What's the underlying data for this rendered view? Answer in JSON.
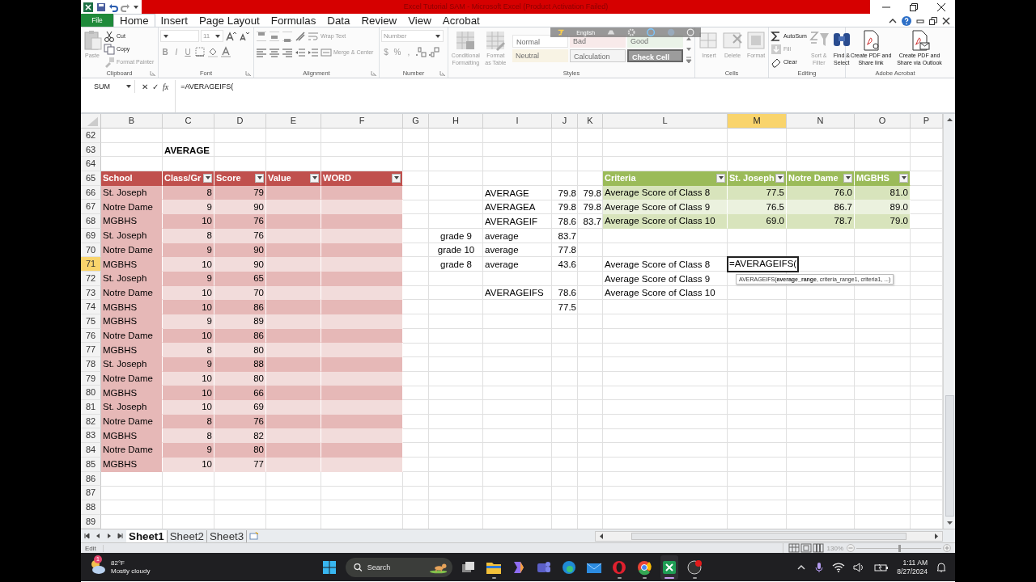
{
  "title_bar": {
    "title": "Excel Tutorial SAM  -  Microsoft Excel (Product Activation Failed)"
  },
  "ribbon": {
    "file_tab": "File",
    "tabs": [
      {
        "label": "Home",
        "selected": true
      },
      {
        "label": "Insert",
        "selected": false
      },
      {
        "label": "Page Layout",
        "selected": false
      },
      {
        "label": "Formulas",
        "selected": false
      },
      {
        "label": "Data",
        "selected": false
      },
      {
        "label": "Review",
        "selected": false
      },
      {
        "label": "View",
        "selected": false
      },
      {
        "label": "Acrobat",
        "selected": false
      }
    ],
    "groups": [
      {
        "kind": "clipboard",
        "label": "Clipboard",
        "items": [
          {
            "label": "Paste",
            "disabled": true
          },
          {
            "label": "Cut",
            "disabled": false
          },
          {
            "label": "Copy",
            "disabled": false
          },
          {
            "label": "Format Painter",
            "disabled": true
          }
        ]
      },
      {
        "kind": "font",
        "label": "Font",
        "disabled": true,
        "size": "11",
        "toggles": [
          "B",
          "I",
          "U"
        ]
      },
      {
        "kind": "alignment",
        "label": "Alignment",
        "disabled": true,
        "items": [
          "Wrap Text",
          "Merge & Center"
        ]
      },
      {
        "kind": "number",
        "label": "Number",
        "disabled": true,
        "format": "Number",
        "symbols": [
          "$",
          "%",
          ","
        ]
      },
      {
        "kind": "styles",
        "label": "Styles",
        "disabled": true,
        "items": [
          "Conditional Formatting",
          "Format as Table"
        ],
        "cell_styles": [
          {
            "label": "Normal",
            "kind": "normal"
          },
          {
            "label": "Bad",
            "kind": "bad"
          },
          {
            "label": "Good",
            "kind": "good"
          },
          {
            "label": "Neutral",
            "kind": "neutral"
          },
          {
            "label": "Calculation",
            "kind": "calculation"
          },
          {
            "label": "Check Cell",
            "kind": "check"
          }
        ]
      },
      {
        "kind": "cells",
        "label": "Cells",
        "items": [
          {
            "label": "Insert",
            "disabled": true
          },
          {
            "label": "Delete",
            "disabled": true
          },
          {
            "label": "Format",
            "disabled": true
          }
        ]
      },
      {
        "kind": "editing",
        "label": "Editing",
        "items": [
          {
            "label": "AutoSum",
            "disabled": false
          },
          {
            "label": "Fill",
            "disabled": true
          },
          {
            "label": "Clear",
            "disabled": false
          },
          {
            "label": "Sort & Filter",
            "disabled": true
          },
          {
            "label": "Find & Select",
            "disabled": false
          }
        ]
      },
      {
        "kind": "acrobat",
        "label": "Adobe Acrobat",
        "items": [
          "Create PDF and Share link",
          "Create PDF and Share via Outlook"
        ]
      }
    ]
  },
  "language_bar": {
    "label": "English"
  },
  "formula_bar": {
    "name_box": "SUM",
    "buttons": [
      "✕",
      "✓",
      "fx"
    ],
    "formula": "=AVERAGEIFS("
  },
  "sheet": {
    "columns": [
      {
        "label": "B",
        "selected": false
      },
      {
        "label": "C",
        "selected": false
      },
      {
        "label": "D",
        "selected": false
      },
      {
        "label": "E",
        "selected": false
      },
      {
        "label": "F",
        "selected": false
      },
      {
        "label": "G",
        "selected": false
      },
      {
        "label": "H",
        "selected": false
      },
      {
        "label": "I",
        "selected": false
      },
      {
        "label": "J",
        "selected": false
      },
      {
        "label": "K",
        "selected": false
      },
      {
        "label": "L",
        "selected": false
      },
      {
        "label": "M",
        "selected": true
      },
      {
        "label": "N",
        "selected": false
      },
      {
        "label": "O",
        "selected": false
      },
      {
        "label": "P",
        "selected": false
      }
    ],
    "tooltip": "AVERAGEIFS(**average_range**, criteria_range1, criteria1, ...)",
    "rows": [
      {
        "label": "62",
        "selected": false
      },
      {
        "label": "63",
        "selected": false,
        "cells": [
          {
            "kind": "empty"
          },
          {
            "kind": "bold",
            "text": "AVERAGE"
          }
        ]
      },
      {
        "label": "64",
        "selected": false
      },
      {
        "label": "65",
        "selected": false,
        "cells": [
          {
            "kind": "head",
            "color": "#c0504d",
            "text": "School",
            "filter": false
          },
          {
            "kind": "head",
            "color": "#c0504d",
            "text": "Class/Gr",
            "filter": true
          },
          {
            "kind": "head",
            "color": "#c0504d",
            "text": "Score",
            "filter": true
          },
          {
            "kind": "head",
            "color": "#c0504d",
            "text": "Value",
            "filter": true
          },
          {
            "kind": "head",
            "color": "#c0504d",
            "text": "WORD",
            "filter": true
          },
          {
            "kind": "empty"
          },
          {
            "kind": "empty"
          },
          {
            "kind": "empty"
          },
          {
            "kind": "empty"
          },
          {
            "kind": "empty"
          },
          {
            "kind": "head",
            "color": "#9bbb59",
            "text": "Criteria",
            "filter": true
          },
          {
            "kind": "head",
            "color": "#9bbb59",
            "text": "St. Joseph",
            "filter": true
          },
          {
            "kind": "head",
            "color": "#9bbb59",
            "text": "Notre Dame",
            "filter": true
          },
          {
            "kind": "head",
            "color": "#9bbb59",
            "text": "MGBHS",
            "filter": true
          }
        ]
      },
      {
        "label": "66",
        "selected": false,
        "cells": [
          {
            "kind": "text",
            "color": "#e6b8b7",
            "text": "St. Joseph"
          },
          {
            "kind": "number",
            "color": "#e6b8b7",
            "text": "8"
          },
          {
            "kind": "number",
            "color": "#e6b8b7",
            "text": "79"
          },
          {
            "kind": "empty",
            "color": "#e6b8b7"
          },
          {
            "kind": "empty",
            "color": "#e6b8b7"
          },
          {
            "kind": "empty"
          },
          {
            "kind": "empty"
          },
          {
            "kind": "text",
            "text": "AVERAGE"
          },
          {
            "kind": "number",
            "text": "79.8"
          },
          {
            "kind": "number",
            "text": "79.8"
          },
          {
            "kind": "text",
            "color": "#d8e4bc",
            "text": "Average Score of Class 8"
          },
          {
            "kind": "number",
            "color": "#d8e4bc",
            "text": "77.5"
          },
          {
            "kind": "number",
            "color": "#d8e4bc",
            "text": "76.0"
          },
          {
            "kind": "number",
            "color": "#d8e4bc",
            "text": "81.0"
          }
        ]
      },
      {
        "label": "67",
        "selected": false,
        "cells": [
          {
            "kind": "text",
            "color": "#e6b8b7",
            "text": "Notre Dame"
          },
          {
            "kind": "number",
            "color": "#f2dcdb",
            "text": "9"
          },
          {
            "kind": "number",
            "color": "#f2dcdb",
            "text": "90"
          },
          {
            "kind": "empty",
            "color": "#f2dcdb"
          },
          {
            "kind": "empty",
            "color": "#f2dcdb"
          },
          {
            "kind": "empty"
          },
          {
            "kind": "empty"
          },
          {
            "kind": "text",
            "text": "AVERAGEA"
          },
          {
            "kind": "number",
            "text": "79.8"
          },
          {
            "kind": "number",
            "text": "79.8"
          },
          {
            "kind": "text",
            "color": "#ebf1de",
            "text": "Average Score of Class 9"
          },
          {
            "kind": "number",
            "color": "#ebf1de",
            "text": "76.5"
          },
          {
            "kind": "number",
            "color": "#ebf1de",
            "text": "86.7"
          },
          {
            "kind": "number",
            "color": "#ebf1de",
            "text": "89.0"
          }
        ]
      },
      {
        "label": "68",
        "selected": false,
        "cells": [
          {
            "kind": "text",
            "color": "#e6b8b7",
            "text": "MGBHS"
          },
          {
            "kind": "number",
            "color": "#e6b8b7",
            "text": "10"
          },
          {
            "kind": "number",
            "color": "#e6b8b7",
            "text": "76"
          },
          {
            "kind": "empty",
            "color": "#e6b8b7"
          },
          {
            "kind": "empty",
            "color": "#e6b8b7"
          },
          {
            "kind": "empty"
          },
          {
            "kind": "empty"
          },
          {
            "kind": "text",
            "text": "AVERAGEIF"
          },
          {
            "kind": "number",
            "text": "78.6"
          },
          {
            "kind": "number",
            "text": "83.7"
          },
          {
            "kind": "text",
            "color": "#d8e4bc",
            "text": "Average Score of Class 10"
          },
          {
            "kind": "number",
            "color": "#d8e4bc",
            "text": "69.0"
          },
          {
            "kind": "number",
            "color": "#d8e4bc",
            "text": "78.7"
          },
          {
            "kind": "number",
            "color": "#d8e4bc",
            "text": "79.0"
          }
        ]
      },
      {
        "label": "69",
        "selected": false,
        "cells": [
          {
            "kind": "text",
            "color": "#e6b8b7",
            "text": "St. Joseph"
          },
          {
            "kind": "number",
            "color": "#f2dcdb",
            "text": "8"
          },
          {
            "kind": "number",
            "color": "#f2dcdb",
            "text": "76"
          },
          {
            "kind": "empty",
            "color": "#f2dcdb"
          },
          {
            "kind": "empty",
            "color": "#f2dcdb"
          },
          {
            "kind": "empty"
          },
          {
            "kind": "center",
            "text": "grade 9"
          },
          {
            "kind": "text",
            "text": "average"
          },
          {
            "kind": "number",
            "text": "83.7"
          }
        ]
      },
      {
        "label": "70",
        "selected": false,
        "cells": [
          {
            "kind": "text",
            "color": "#e6b8b7",
            "text": "Notre Dame"
          },
          {
            "kind": "number",
            "color": "#e6b8b7",
            "text": "9"
          },
          {
            "kind": "number",
            "color": "#e6b8b7",
            "text": "90"
          },
          {
            "kind": "empty",
            "color": "#e6b8b7"
          },
          {
            "kind": "empty",
            "color": "#e6b8b7"
          },
          {
            "kind": "empty"
          },
          {
            "kind": "center",
            "text": "grade 10"
          },
          {
            "kind": "text",
            "text": "average"
          },
          {
            "kind": "number",
            "text": "77.8"
          }
        ]
      },
      {
        "label": "71",
        "selected": true,
        "cells": [
          {
            "kind": "text",
            "color": "#e6b8b7",
            "text": "MGBHS"
          },
          {
            "kind": "number",
            "color": "#f2dcdb",
            "text": "10"
          },
          {
            "kind": "number",
            "color": "#f2dcdb",
            "text": "90"
          },
          {
            "kind": "empty",
            "color": "#f2dcdb"
          },
          {
            "kind": "empty",
            "color": "#f2dcdb"
          },
          {
            "kind": "empty"
          },
          {
            "kind": "center",
            "text": "grade 8"
          },
          {
            "kind": "text",
            "text": "average"
          },
          {
            "kind": "number",
            "text": "43.6"
          },
          {
            "kind": "empty"
          },
          {
            "kind": "text",
            "text": "Average Score of Class 8"
          },
          {
            "kind": "edit",
            "text": "=AVERAGEIFS("
          }
        ]
      },
      {
        "label": "72",
        "selected": false,
        "cells": [
          {
            "kind": "text",
            "color": "#e6b8b7",
            "text": "St. Joseph"
          },
          {
            "kind": "number",
            "color": "#e6b8b7",
            "text": "9"
          },
          {
            "kind": "number",
            "color": "#e6b8b7",
            "text": "65"
          },
          {
            "kind": "empty",
            "color": "#e6b8b7"
          },
          {
            "kind": "empty",
            "color": "#e6b8b7"
          },
          {
            "kind": "empty"
          },
          {
            "kind": "empty"
          },
          {
            "kind": "empty"
          },
          {
            "kind": "empty"
          },
          {
            "kind": "empty"
          },
          {
            "kind": "text",
            "text": "Average Score of Class 9"
          }
        ]
      },
      {
        "label": "73",
        "selected": false,
        "cells": [
          {
            "kind": "text",
            "color": "#e6b8b7",
            "text": "Notre Dame"
          },
          {
            "kind": "number",
            "color": "#f2dcdb",
            "text": "10"
          },
          {
            "kind": "number",
            "color": "#f2dcdb",
            "text": "70"
          },
          {
            "kind": "empty",
            "color": "#f2dcdb"
          },
          {
            "kind": "empty",
            "color": "#f2dcdb"
          },
          {
            "kind": "empty"
          },
          {
            "kind": "empty"
          },
          {
            "kind": "text",
            "text": "AVERAGEIFS"
          },
          {
            "kind": "number",
            "text": "78.6"
          },
          {
            "kind": "empty"
          },
          {
            "kind": "text",
            "text": "Average Score of Class 10"
          }
        ]
      },
      {
        "label": "74",
        "selected": false,
        "cells": [
          {
            "kind": "text",
            "color": "#e6b8b7",
            "text": "MGBHS"
          },
          {
            "kind": "number",
            "color": "#e6b8b7",
            "text": "10"
          },
          {
            "kind": "number",
            "color": "#e6b8b7",
            "text": "86"
          },
          {
            "kind": "empty",
            "color": "#e6b8b7"
          },
          {
            "kind": "empty",
            "color": "#e6b8b7"
          },
          {
            "kind": "empty"
          },
          {
            "kind": "empty"
          },
          {
            "kind": "empty"
          },
          {
            "kind": "number",
            "text": "77.5"
          }
        ]
      },
      {
        "label": "75",
        "selected": false,
        "cells": [
          {
            "kind": "text",
            "color": "#e6b8b7",
            "text": "MGBHS"
          },
          {
            "kind": "number",
            "color": "#f2dcdb",
            "text": "9"
          },
          {
            "kind": "number",
            "color": "#f2dcdb",
            "text": "89"
          },
          {
            "kind": "empty",
            "color": "#f2dcdb"
          },
          {
            "kind": "empty",
            "color": "#f2dcdb"
          }
        ]
      },
      {
        "label": "76",
        "selected": false,
        "cells": [
          {
            "kind": "text",
            "color": "#e6b8b7",
            "text": "Notre Dame"
          },
          {
            "kind": "number",
            "color": "#e6b8b7",
            "text": "10"
          },
          {
            "kind": "number",
            "color": "#e6b8b7",
            "text": "86"
          },
          {
            "kind": "empty",
            "color": "#e6b8b7"
          },
          {
            "kind": "empty",
            "color": "#e6b8b7"
          }
        ]
      },
      {
        "label": "77",
        "selected": false,
        "cells": [
          {
            "kind": "text",
            "color": "#e6b8b7",
            "text": "MGBHS"
          },
          {
            "kind": "number",
            "color": "#f2dcdb",
            "text": "8"
          },
          {
            "kind": "number",
            "color": "#f2dcdb",
            "text": "80"
          },
          {
            "kind": "empty",
            "color": "#f2dcdb"
          },
          {
            "kind": "empty",
            "color": "#f2dcdb"
          }
        ]
      },
      {
        "label": "78",
        "selected": false,
        "cells": [
          {
            "kind": "text",
            "color": "#e6b8b7",
            "text": "St. Joseph"
          },
          {
            "kind": "number",
            "color": "#e6b8b7",
            "text": "9"
          },
          {
            "kind": "number",
            "color": "#e6b8b7",
            "text": "88"
          },
          {
            "kind": "empty",
            "color": "#e6b8b7"
          },
          {
            "kind": "empty",
            "color": "#e6b8b7"
          }
        ]
      },
      {
        "label": "79",
        "selected": false,
        "cells": [
          {
            "kind": "text",
            "color": "#e6b8b7",
            "text": "Notre Dame"
          },
          {
            "kind": "number",
            "color": "#f2dcdb",
            "text": "10"
          },
          {
            "kind": "number",
            "color": "#f2dcdb",
            "text": "80"
          },
          {
            "kind": "empty",
            "color": "#f2dcdb"
          },
          {
            "kind": "empty",
            "color": "#f2dcdb"
          }
        ]
      },
      {
        "label": "80",
        "selected": false,
        "cells": [
          {
            "kind": "text",
            "color": "#e6b8b7",
            "text": "MGBHS"
          },
          {
            "kind": "number",
            "color": "#e6b8b7",
            "text": "10"
          },
          {
            "kind": "number",
            "color": "#e6b8b7",
            "text": "66"
          },
          {
            "kind": "empty",
            "color": "#e6b8b7"
          },
          {
            "kind": "empty",
            "color": "#e6b8b7"
          }
        ]
      },
      {
        "label": "81",
        "selected": false,
        "cells": [
          {
            "kind": "text",
            "color": "#e6b8b7",
            "text": "St. Joseph"
          },
          {
            "kind": "number",
            "color": "#f2dcdb",
            "text": "10"
          },
          {
            "kind": "number",
            "color": "#f2dcdb",
            "text": "69"
          },
          {
            "kind": "empty",
            "color": "#f2dcdb"
          },
          {
            "kind": "empty",
            "color": "#f2dcdb"
          }
        ]
      },
      {
        "label": "82",
        "selected": false,
        "cells": [
          {
            "kind": "text",
            "color": "#e6b8b7",
            "text": "Notre Dame"
          },
          {
            "kind": "number",
            "color": "#e6b8b7",
            "text": "8"
          },
          {
            "kind": "number",
            "color": "#e6b8b7",
            "text": "76"
          },
          {
            "kind": "empty",
            "color": "#e6b8b7"
          },
          {
            "kind": "empty",
            "color": "#e6b8b7"
          }
        ]
      },
      {
        "label": "83",
        "selected": false,
        "cells": [
          {
            "kind": "text",
            "color": "#e6b8b7",
            "text": "MGBHS"
          },
          {
            "kind": "number",
            "color": "#f2dcdb",
            "text": "8"
          },
          {
            "kind": "number",
            "color": "#f2dcdb",
            "text": "82"
          },
          {
            "kind": "empty",
            "color": "#f2dcdb"
          },
          {
            "kind": "empty",
            "color": "#f2dcdb"
          }
        ]
      },
      {
        "label": "84",
        "selected": false,
        "cells": [
          {
            "kind": "text",
            "color": "#e6b8b7",
            "text": "Notre Dame"
          },
          {
            "kind": "number",
            "color": "#e6b8b7",
            "text": "9"
          },
          {
            "kind": "number",
            "color": "#e6b8b7",
            "text": "80"
          },
          {
            "kind": "empty",
            "color": "#e6b8b7"
          },
          {
            "kind": "empty",
            "color": "#e6b8b7"
          }
        ]
      },
      {
        "label": "85",
        "selected": false,
        "cells": [
          {
            "kind": "text",
            "color": "#e6b8b7",
            "text": "MGBHS"
          },
          {
            "kind": "number",
            "color": "#f2dcdb",
            "text": "10"
          },
          {
            "kind": "number",
            "color": "#f2dcdb",
            "text": "77"
          },
          {
            "kind": "empty",
            "color": "#f2dcdb"
          },
          {
            "kind": "empty",
            "color": "#f2dcdb"
          }
        ]
      },
      {
        "label": "86",
        "selected": false
      },
      {
        "label": "87",
        "selected": false
      },
      {
        "label": "88",
        "selected": false
      },
      {
        "label": "89",
        "selected": false
      }
    ]
  },
  "sheet_tabs": [
    {
      "label": "Sheet1",
      "selected": true
    },
    {
      "label": "Sheet2",
      "selected": false
    },
    {
      "label": "Sheet3",
      "selected": false
    }
  ],
  "status_bar": {
    "mode": "Edit",
    "zoom": {
      "reading": "130%",
      "level": 0.5
    }
  },
  "taskbar": {
    "weather": {
      "badge": "1",
      "temperature": "82°F",
      "condition": "Mostly cloudy"
    },
    "search": {
      "placeholder": "Search"
    },
    "apps": [
      {
        "kind": "taskview",
        "running": false,
        "active": false
      },
      {
        "kind": "explorer",
        "running": true,
        "active": false
      },
      {
        "kind": "copilot",
        "running": false,
        "active": false
      },
      {
        "kind": "teams",
        "running": false,
        "active": false
      },
      {
        "kind": "edge",
        "running": false,
        "active": false
      },
      {
        "kind": "mail",
        "running": false,
        "active": false
      },
      {
        "kind": "opera",
        "running": true,
        "active": false
      },
      {
        "kind": "chrome",
        "running": true,
        "active": false
      },
      {
        "kind": "excel",
        "running": true,
        "active": true
      },
      {
        "kind": "obs",
        "running": true,
        "active": false
      }
    ],
    "time": "1:11 AM",
    "date": "8/27/2024"
  }
}
